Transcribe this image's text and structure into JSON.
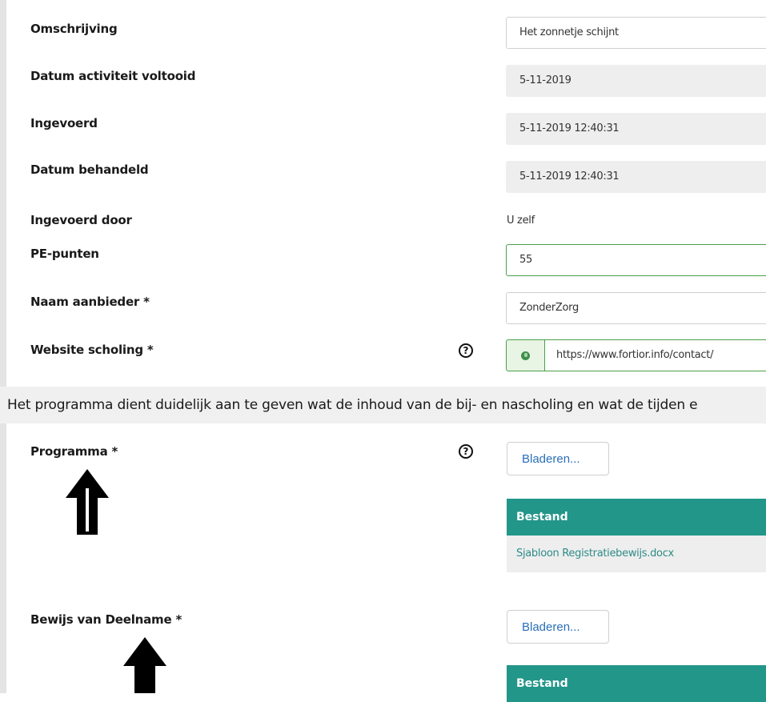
{
  "form": {
    "omschrijving": {
      "label": "Omschrijving",
      "value": "Het zonnetje schijnt"
    },
    "datum_voltooid": {
      "label": "Datum activiteit voltooid",
      "value": "5-11-2019"
    },
    "ingevoerd": {
      "label": "Ingevoerd",
      "value": "5-11-2019 12:40:31"
    },
    "datum_behandeld": {
      "label": "Datum behandeld",
      "value": "5-11-2019 12:40:31"
    },
    "ingevoerd_door": {
      "label": "Ingevoerd door",
      "value": "U zelf"
    },
    "pe_punten": {
      "label": "PE-punten",
      "value": "55"
    },
    "naam_aanbieder": {
      "label": "Naam aanbieder *",
      "value": "ZonderZorg"
    },
    "website_scholing": {
      "label": "Website scholing *",
      "value": "https://www.fortior.info/contact/"
    }
  },
  "info_text": "Het programma dient duidelijk aan te geven wat de inhoud van de bij- en nascholing en wat de tijden e",
  "programma": {
    "label": "Programma *",
    "browse_label": "Bladeren...",
    "table_header": "Bestand",
    "files": [
      "Sjabloon Registratiebewijs.docx"
    ]
  },
  "bewijs": {
    "label": "Bewijs van Deelname  *",
    "browse_label": "Bladeren...",
    "table_header": "Bestand"
  },
  "icons": {
    "help": "question-circle-icon",
    "globe": "globe-icon",
    "arrow": "arrow-up-icon"
  },
  "help_glyph": "?",
  "colors": {
    "accent_teal": "#23968a",
    "valid_green": "#4aa04a",
    "link_blue": "#2a6fb8"
  }
}
